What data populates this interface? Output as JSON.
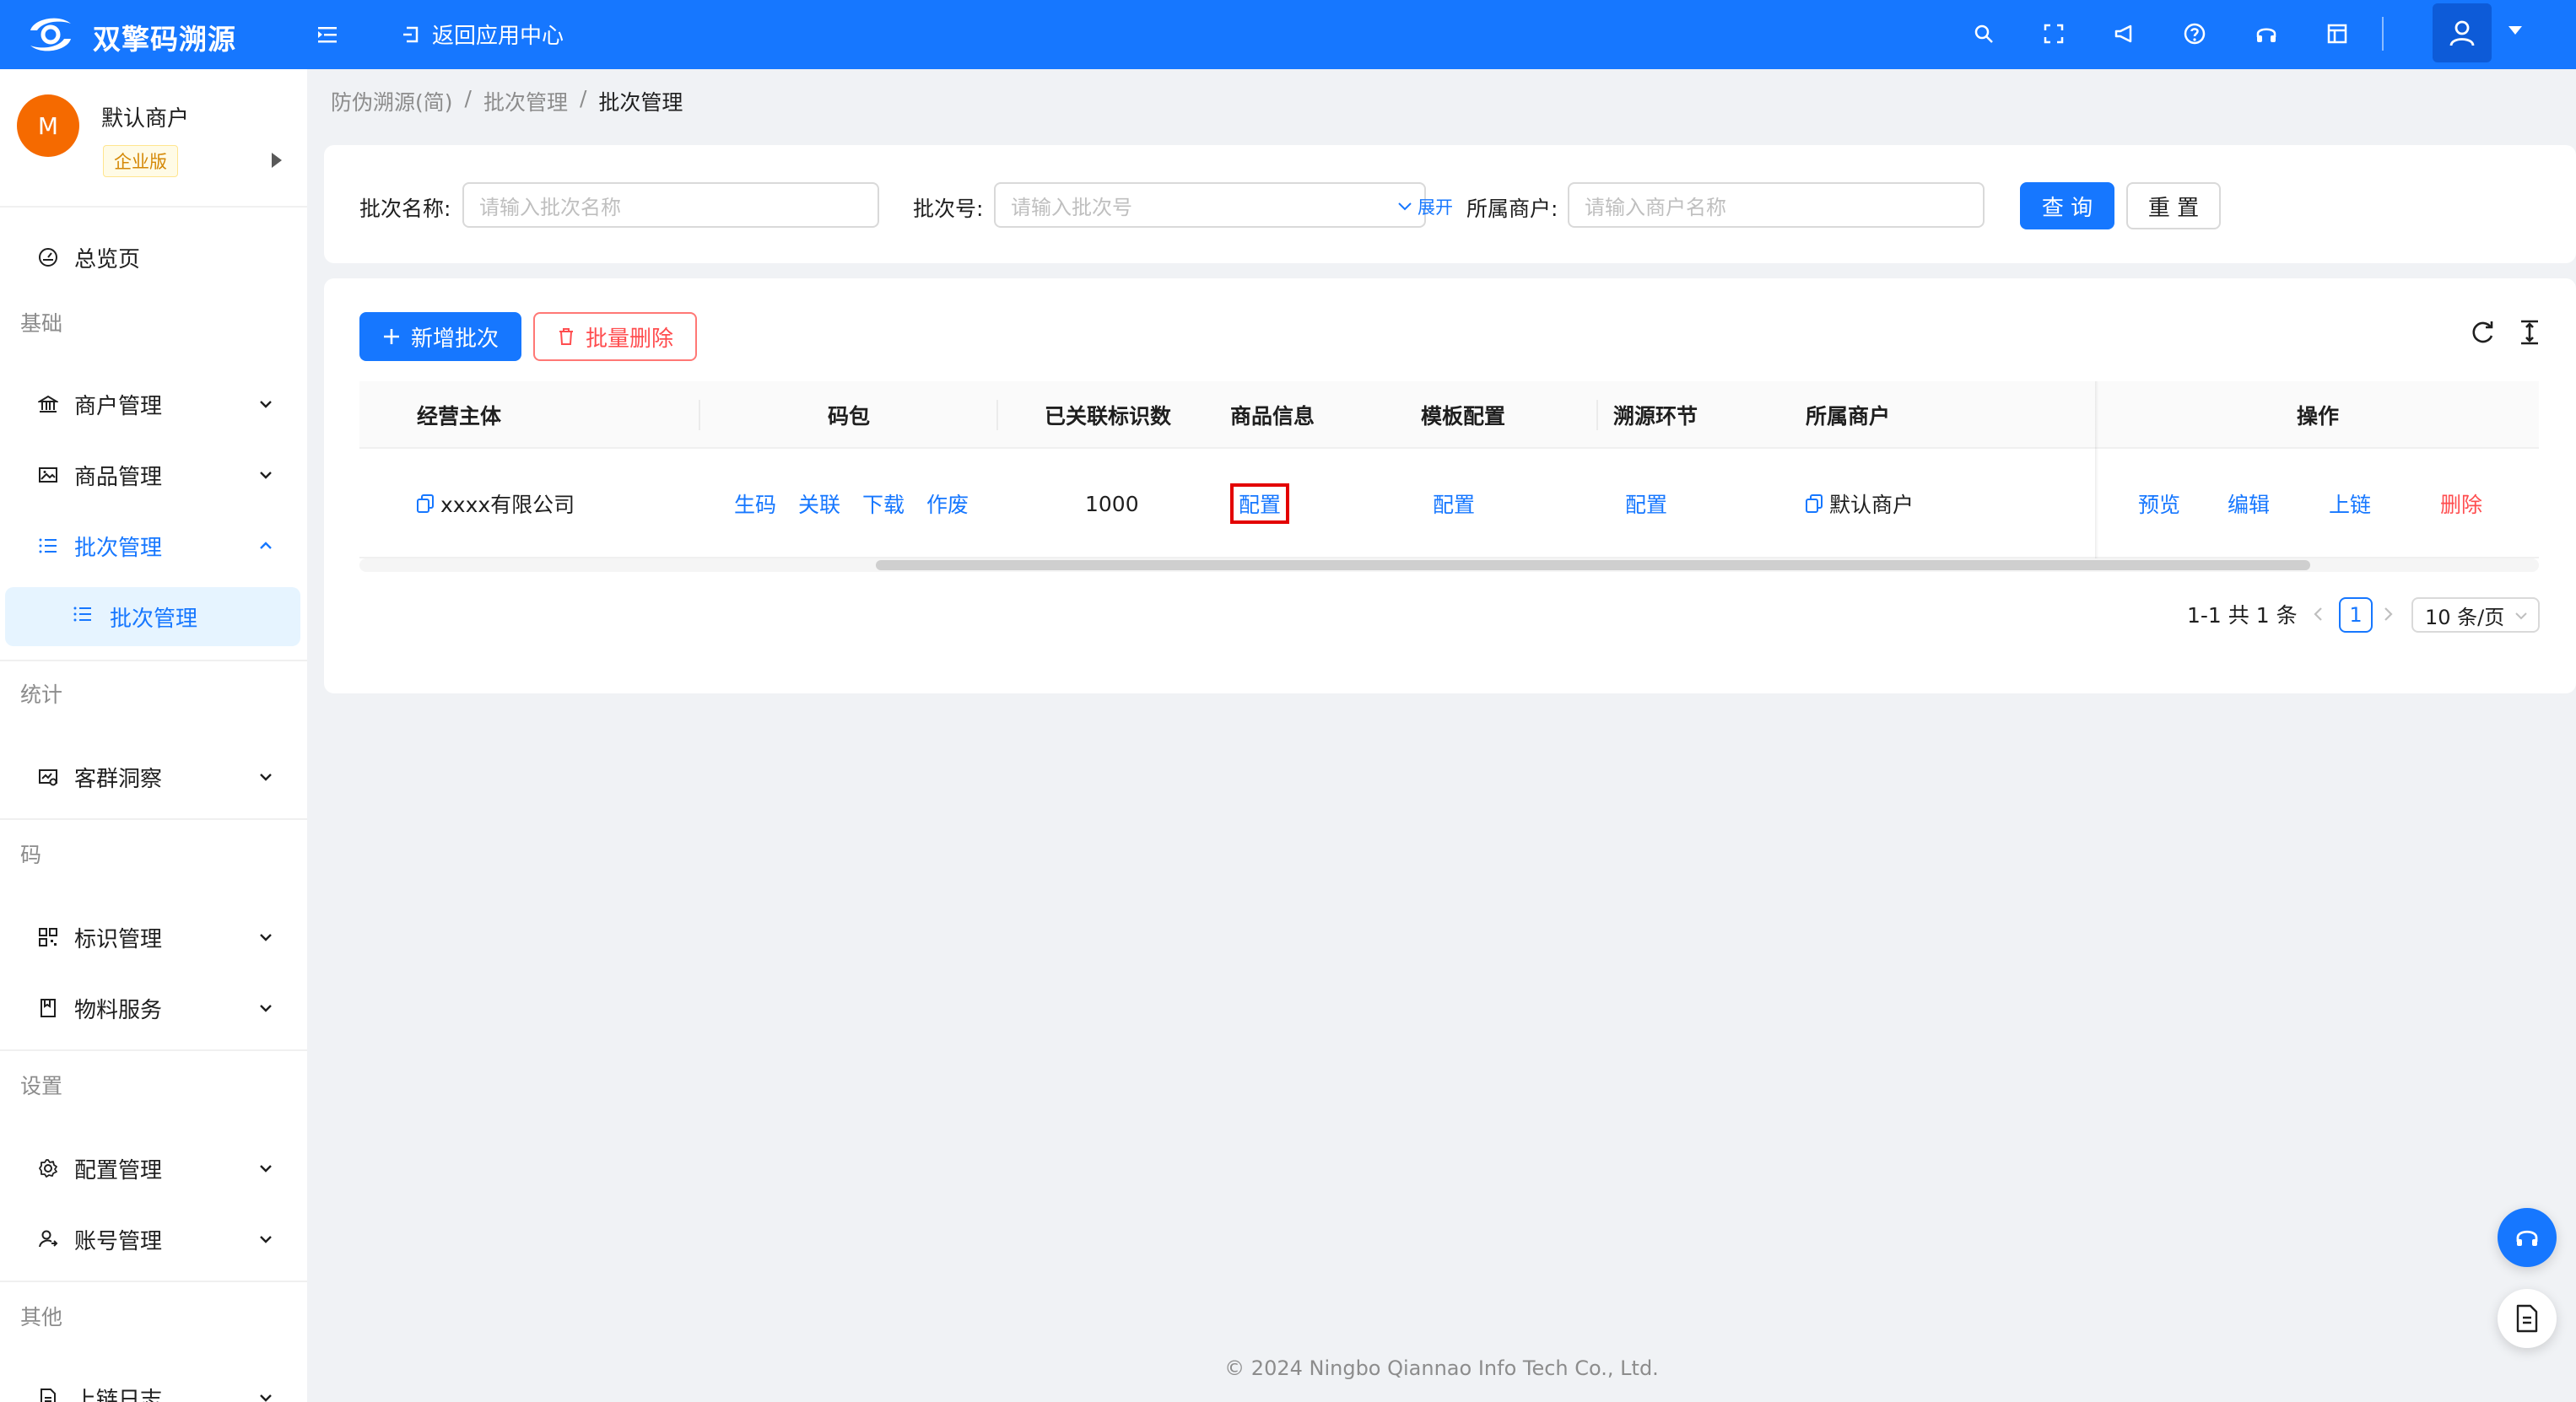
{
  "app": {
    "brand": "双擎码溯源",
    "back_label": "返回应用中心",
    "header_icons": [
      "search-icon",
      "fullscreen-icon",
      "announcement-icon",
      "help-icon",
      "headset-icon",
      "layout-icon"
    ],
    "accent": "#1677ff"
  },
  "merchant": {
    "avatar_letter": "M",
    "name": "默认商户",
    "tag": "企业版"
  },
  "sidebar": {
    "overview": "总览页",
    "groups": {
      "basic": "基础",
      "stats": "统计",
      "code": "码",
      "settings": "设置",
      "other": "其他"
    },
    "items": {
      "merchant_mgmt": "商户管理",
      "product_mgmt": "商品管理",
      "batch_mgmt": "批次管理",
      "batch_mgmt_sub": "批次管理",
      "customer_insight": "客群洞察",
      "id_mgmt": "标识管理",
      "material_service": "物料服务",
      "config_mgmt": "配置管理",
      "account_mgmt": "账号管理",
      "chain_log": "上链日志"
    }
  },
  "breadcrumb": [
    "防伪溯源(简)",
    "批次管理",
    "批次管理"
  ],
  "search": {
    "batch_name_label": "批次名称:",
    "batch_name_placeholder": "请输入批次名称",
    "batch_no_label": "批次号:",
    "batch_no_placeholder": "请输入批次号",
    "merchant_label": "所属商户:",
    "merchant_placeholder": "请输入商户名称",
    "query": "查 询",
    "reset": "重 置",
    "expand": "展开"
  },
  "toolbar": {
    "add": "新增批次",
    "batch_delete": "批量删除"
  },
  "table": {
    "columns": [
      "经营主体",
      "码包",
      "已关联标识数",
      "商品信息",
      "模板配置",
      "溯源环节",
      "所属商户",
      "操作"
    ],
    "rows": [
      {
        "entity": "xxxx有限公司",
        "code_pkg": [
          "生码",
          "关联",
          "下载",
          "作废"
        ],
        "linked_count": "1000",
        "product_info": "配置",
        "template_config": "配置",
        "trace_step": "配置",
        "merchant": "默认商户",
        "actions": [
          "预览",
          "编辑",
          "上链",
          "删除"
        ]
      }
    ]
  },
  "pagination": {
    "summary": "1-1 共 1 条",
    "current_page": "1",
    "page_size": "10 条/页"
  },
  "footer": "© 2024 Ningbo Qiannao Info Tech Co., Ltd."
}
